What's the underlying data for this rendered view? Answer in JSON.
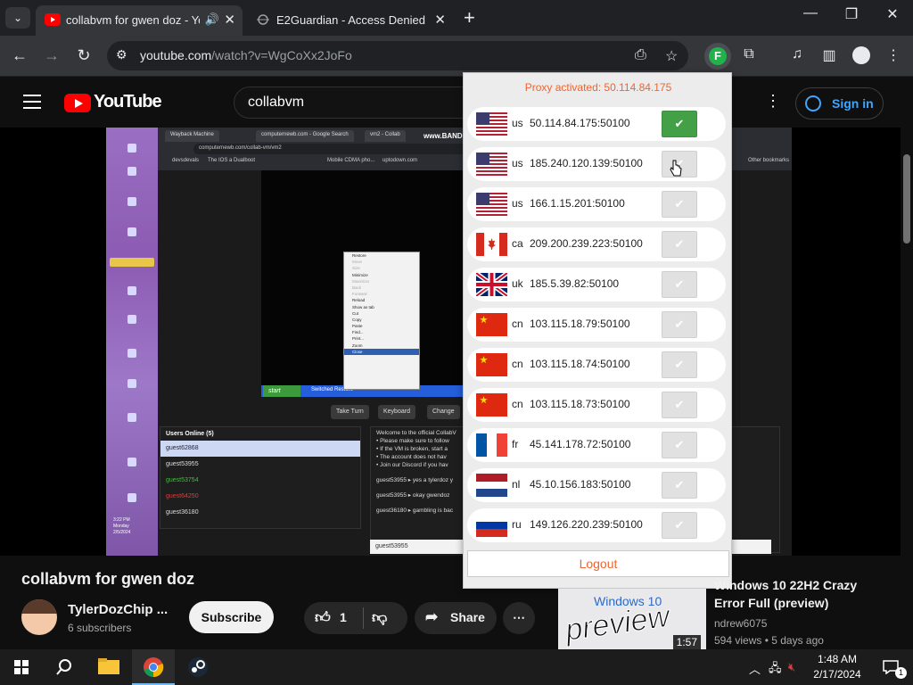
{
  "browser": {
    "tabs": [
      {
        "title": "collabvm for gwen doz - Yo",
        "favicon": "youtube-icon",
        "active": true
      },
      {
        "title": "E2Guardian - Access Denied",
        "favicon": "e2guardian-icon",
        "active": false
      }
    ],
    "new_tab_label": "+",
    "address": {
      "host": "youtube.com",
      "path": "/watch?v=WgCoXx2JoFo"
    }
  },
  "youtube": {
    "logo_text": "YouTube",
    "search_query": "collabvm",
    "sign_in_label": "Sign in"
  },
  "video_content": {
    "vm_tabs": [
      "Wayback Machine",
      "computernewb.com - Google Search",
      "vm2 - Collab"
    ],
    "vm_url": "computernewb.com/collab-vm/vm2",
    "vm_bookmarks": [
      "devsdevals",
      "The IOS a Dualboot",
      "Mobile CDMA pho...",
      "uptodown.com",
      "Other bookmarks"
    ],
    "bandicam": "www.BANDICA",
    "context_menu": [
      "Restore",
      "Move",
      "Size",
      "Minimize",
      "Maximize",
      "Back",
      "Forward",
      "Reload",
      "Show as tab",
      "Cut",
      "Copy",
      "Paste",
      "Find...",
      "Print...",
      "Zoom",
      "Close"
    ],
    "start_label": "start",
    "taskbar_item": "Switched Restore",
    "controls": [
      "Take Turn",
      "Keyboard",
      "Change"
    ],
    "users_header": "Users Online (5)",
    "users": [
      "guest62868",
      "guest53955",
      "guest53754",
      "guest64250",
      "guest36180"
    ],
    "chat_intro": [
      "Welcome to the official CollabV",
      "• Please make sure to follow",
      "• If the VM is broken, start a",
      "• The account does not hav",
      "• Join our Discord if you hav"
    ],
    "chat_lines": [
      "guest53955 ▸ yes a tylerdoz y",
      "guest53955 ▸ okay gwendoz",
      "guest36180 ▸ gambling is bac"
    ],
    "chat_input": "guest53955",
    "vm_clock": [
      "3:22 PM",
      "Monday",
      "2/5/2024"
    ]
  },
  "proxy_popup": {
    "status": "Proxy activated: 50.114.84.175",
    "proxies": [
      {
        "cc": "us",
        "address": "50.114.84.175:50100",
        "flag": "us",
        "active": true
      },
      {
        "cc": "us",
        "address": "185.240.120.139:50100",
        "flag": "us",
        "active": false
      },
      {
        "cc": "us",
        "address": "166.1.15.201:50100",
        "flag": "us",
        "active": false
      },
      {
        "cc": "ca",
        "address": "209.200.239.223:50100",
        "flag": "ca",
        "active": false
      },
      {
        "cc": "uk",
        "address": "185.5.39.82:50100",
        "flag": "uk",
        "active": false
      },
      {
        "cc": "cn",
        "address": "103.115.18.79:50100",
        "flag": "cn",
        "active": false
      },
      {
        "cc": "cn",
        "address": "103.115.18.74:50100",
        "flag": "cn",
        "active": false
      },
      {
        "cc": "cn",
        "address": "103.115.18.73:50100",
        "flag": "cn",
        "active": false
      },
      {
        "cc": "fr",
        "address": "45.141.178.72:50100",
        "flag": "fr",
        "active": false
      },
      {
        "cc": "nl",
        "address": "45.10.156.183:50100",
        "flag": "nl",
        "active": false
      },
      {
        "cc": "ru",
        "address": "149.126.220.239:50100",
        "flag": "ru",
        "active": false
      }
    ],
    "check_glyph": "✔",
    "logout_label": "Logout",
    "colors": {
      "accent": "#f0642e",
      "active_check": "#43a047"
    }
  },
  "video_info": {
    "title": "collabvm for gwen doz",
    "channel": "TylerDozChip ...",
    "subscribers": "6 subscribers",
    "subscribe_label": "Subscribe",
    "likes": "1",
    "share_label": "Share"
  },
  "recommendation": {
    "thumb_text": "Windows 10",
    "thumb_overlay": "preview",
    "duration": "1:57",
    "title": "Windows 10 22H2 Crazy Error Full (preview)",
    "channel": "ndrew6075",
    "meta": "594 views • 5 days ago"
  },
  "taskbar": {
    "time": "1:48 AM",
    "date": "2/17/2024",
    "notification_count": "1"
  }
}
